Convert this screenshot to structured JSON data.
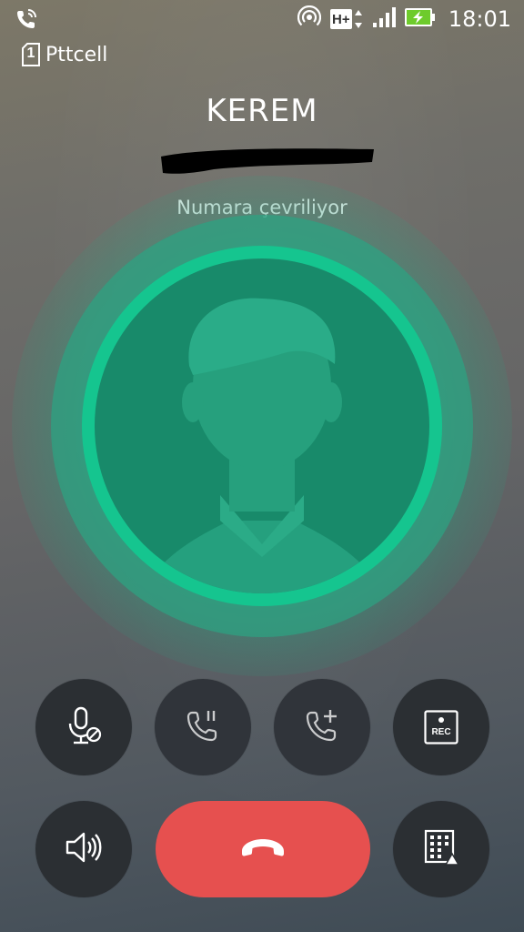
{
  "status_bar": {
    "time": "18:01",
    "network_type": "H+",
    "icons": [
      "wifi-calling-icon",
      "hotspot-icon",
      "network-hplus-icon",
      "signal-icon",
      "battery-charging-icon"
    ]
  },
  "carrier": {
    "sim_slot": "1",
    "name": "Pttcell"
  },
  "call": {
    "caller_name": "KEREM",
    "status_text": "Numara çevriliyor"
  },
  "controls": {
    "row1": [
      {
        "name": "mute-button",
        "icon": "microphone-mute-icon"
      },
      {
        "name": "hold-button",
        "icon": "phone-hold-icon"
      },
      {
        "name": "add-call-button",
        "icon": "phone-add-icon"
      },
      {
        "name": "record-button",
        "icon": "rec-icon",
        "label": "REC"
      }
    ],
    "row2": [
      {
        "name": "speaker-button",
        "icon": "speaker-icon"
      },
      {
        "name": "end-call-button",
        "icon": "hang-up-icon"
      },
      {
        "name": "keypad-button",
        "icon": "dialpad-icon"
      }
    ]
  },
  "colors": {
    "accent_green": "#18c08f",
    "end_call_red": "#e6504f",
    "button_dark": "#2b2f33"
  }
}
